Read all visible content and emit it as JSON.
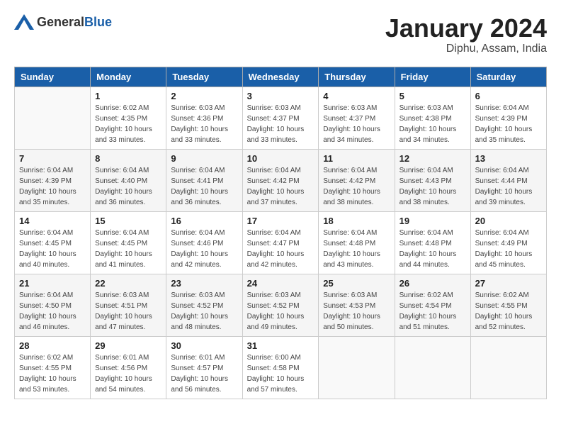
{
  "header": {
    "logo_general": "General",
    "logo_blue": "Blue",
    "month": "January 2024",
    "location": "Diphu, Assam, India"
  },
  "weekdays": [
    "Sunday",
    "Monday",
    "Tuesday",
    "Wednesday",
    "Thursday",
    "Friday",
    "Saturday"
  ],
  "weeks": [
    [
      {
        "day": "",
        "sunrise": "",
        "sunset": "",
        "daylight": ""
      },
      {
        "day": "1",
        "sunrise": "Sunrise: 6:02 AM",
        "sunset": "Sunset: 4:35 PM",
        "daylight": "Daylight: 10 hours and 33 minutes."
      },
      {
        "day": "2",
        "sunrise": "Sunrise: 6:03 AM",
        "sunset": "Sunset: 4:36 PM",
        "daylight": "Daylight: 10 hours and 33 minutes."
      },
      {
        "day": "3",
        "sunrise": "Sunrise: 6:03 AM",
        "sunset": "Sunset: 4:37 PM",
        "daylight": "Daylight: 10 hours and 33 minutes."
      },
      {
        "day": "4",
        "sunrise": "Sunrise: 6:03 AM",
        "sunset": "Sunset: 4:37 PM",
        "daylight": "Daylight: 10 hours and 34 minutes."
      },
      {
        "day": "5",
        "sunrise": "Sunrise: 6:03 AM",
        "sunset": "Sunset: 4:38 PM",
        "daylight": "Daylight: 10 hours and 34 minutes."
      },
      {
        "day": "6",
        "sunrise": "Sunrise: 6:04 AM",
        "sunset": "Sunset: 4:39 PM",
        "daylight": "Daylight: 10 hours and 35 minutes."
      }
    ],
    [
      {
        "day": "7",
        "sunrise": "Sunrise: 6:04 AM",
        "sunset": "Sunset: 4:39 PM",
        "daylight": "Daylight: 10 hours and 35 minutes."
      },
      {
        "day": "8",
        "sunrise": "Sunrise: 6:04 AM",
        "sunset": "Sunset: 4:40 PM",
        "daylight": "Daylight: 10 hours and 36 minutes."
      },
      {
        "day": "9",
        "sunrise": "Sunrise: 6:04 AM",
        "sunset": "Sunset: 4:41 PM",
        "daylight": "Daylight: 10 hours and 36 minutes."
      },
      {
        "day": "10",
        "sunrise": "Sunrise: 6:04 AM",
        "sunset": "Sunset: 4:42 PM",
        "daylight": "Daylight: 10 hours and 37 minutes."
      },
      {
        "day": "11",
        "sunrise": "Sunrise: 6:04 AM",
        "sunset": "Sunset: 4:42 PM",
        "daylight": "Daylight: 10 hours and 38 minutes."
      },
      {
        "day": "12",
        "sunrise": "Sunrise: 6:04 AM",
        "sunset": "Sunset: 4:43 PM",
        "daylight": "Daylight: 10 hours and 38 minutes."
      },
      {
        "day": "13",
        "sunrise": "Sunrise: 6:04 AM",
        "sunset": "Sunset: 4:44 PM",
        "daylight": "Daylight: 10 hours and 39 minutes."
      }
    ],
    [
      {
        "day": "14",
        "sunrise": "Sunrise: 6:04 AM",
        "sunset": "Sunset: 4:45 PM",
        "daylight": "Daylight: 10 hours and 40 minutes."
      },
      {
        "day": "15",
        "sunrise": "Sunrise: 6:04 AM",
        "sunset": "Sunset: 4:45 PM",
        "daylight": "Daylight: 10 hours and 41 minutes."
      },
      {
        "day": "16",
        "sunrise": "Sunrise: 6:04 AM",
        "sunset": "Sunset: 4:46 PM",
        "daylight": "Daylight: 10 hours and 42 minutes."
      },
      {
        "day": "17",
        "sunrise": "Sunrise: 6:04 AM",
        "sunset": "Sunset: 4:47 PM",
        "daylight": "Daylight: 10 hours and 42 minutes."
      },
      {
        "day": "18",
        "sunrise": "Sunrise: 6:04 AM",
        "sunset": "Sunset: 4:48 PM",
        "daylight": "Daylight: 10 hours and 43 minutes."
      },
      {
        "day": "19",
        "sunrise": "Sunrise: 6:04 AM",
        "sunset": "Sunset: 4:48 PM",
        "daylight": "Daylight: 10 hours and 44 minutes."
      },
      {
        "day": "20",
        "sunrise": "Sunrise: 6:04 AM",
        "sunset": "Sunset: 4:49 PM",
        "daylight": "Daylight: 10 hours and 45 minutes."
      }
    ],
    [
      {
        "day": "21",
        "sunrise": "Sunrise: 6:04 AM",
        "sunset": "Sunset: 4:50 PM",
        "daylight": "Daylight: 10 hours and 46 minutes."
      },
      {
        "day": "22",
        "sunrise": "Sunrise: 6:03 AM",
        "sunset": "Sunset: 4:51 PM",
        "daylight": "Daylight: 10 hours and 47 minutes."
      },
      {
        "day": "23",
        "sunrise": "Sunrise: 6:03 AM",
        "sunset": "Sunset: 4:52 PM",
        "daylight": "Daylight: 10 hours and 48 minutes."
      },
      {
        "day": "24",
        "sunrise": "Sunrise: 6:03 AM",
        "sunset": "Sunset: 4:52 PM",
        "daylight": "Daylight: 10 hours and 49 minutes."
      },
      {
        "day": "25",
        "sunrise": "Sunrise: 6:03 AM",
        "sunset": "Sunset: 4:53 PM",
        "daylight": "Daylight: 10 hours and 50 minutes."
      },
      {
        "day": "26",
        "sunrise": "Sunrise: 6:02 AM",
        "sunset": "Sunset: 4:54 PM",
        "daylight": "Daylight: 10 hours and 51 minutes."
      },
      {
        "day": "27",
        "sunrise": "Sunrise: 6:02 AM",
        "sunset": "Sunset: 4:55 PM",
        "daylight": "Daylight: 10 hours and 52 minutes."
      }
    ],
    [
      {
        "day": "28",
        "sunrise": "Sunrise: 6:02 AM",
        "sunset": "Sunset: 4:55 PM",
        "daylight": "Daylight: 10 hours and 53 minutes."
      },
      {
        "day": "29",
        "sunrise": "Sunrise: 6:01 AM",
        "sunset": "Sunset: 4:56 PM",
        "daylight": "Daylight: 10 hours and 54 minutes."
      },
      {
        "day": "30",
        "sunrise": "Sunrise: 6:01 AM",
        "sunset": "Sunset: 4:57 PM",
        "daylight": "Daylight: 10 hours and 56 minutes."
      },
      {
        "day": "31",
        "sunrise": "Sunrise: 6:00 AM",
        "sunset": "Sunset: 4:58 PM",
        "daylight": "Daylight: 10 hours and 57 minutes."
      },
      {
        "day": "",
        "sunrise": "",
        "sunset": "",
        "daylight": ""
      },
      {
        "day": "",
        "sunrise": "",
        "sunset": "",
        "daylight": ""
      },
      {
        "day": "",
        "sunrise": "",
        "sunset": "",
        "daylight": ""
      }
    ]
  ]
}
